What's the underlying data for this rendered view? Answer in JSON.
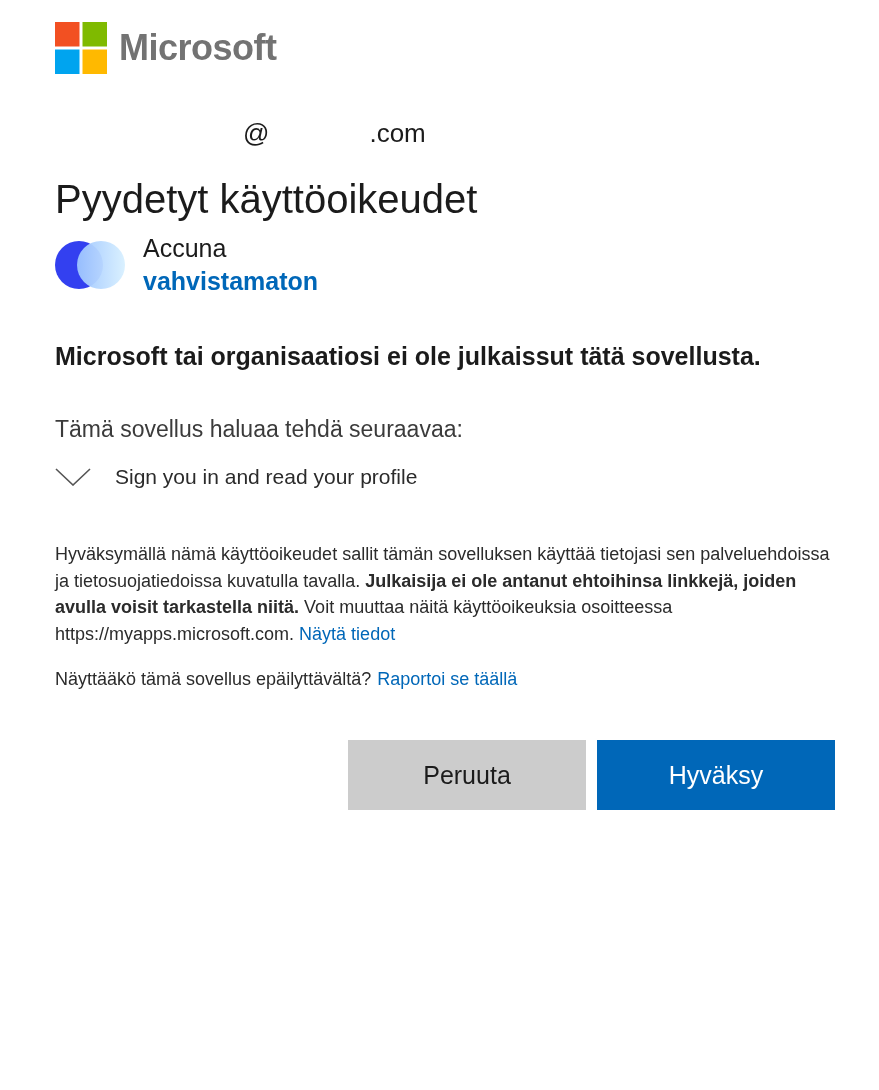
{
  "logo": {
    "text": "Microsoft"
  },
  "account": {
    "at": "@",
    "domain": ".com"
  },
  "title": "Pyydetyt käyttöoikeudet",
  "app": {
    "name": "Accuna",
    "status": "vahvistamaton"
  },
  "warning": "Microsoft tai organisaatiosi ei ole julkaissut tätä sovellusta.",
  "intro": "Tämä sovellus haluaa tehdä seuraavaa:",
  "permissions": [
    {
      "label": "Sign you in and read your profile",
      "expanded": false
    }
  ],
  "consent": {
    "text": "Hyväksymällä nämä käyttöoikeudet sallit tämän sovelluksen käyttää tietojasi sen palveluehdoissa ja tietosuojatiedoissa kuvatulla tavalla. **Julkaisija ei ole antanut ehtoihinsa linkkejä, joiden avulla voisit tarkastella niitä.** Voit muuttaa näitä käyttöoikeuksia osoitteessa https://myapps.microsoft.com.",
    "link": "Näytä tiedot"
  },
  "report": {
    "text": "Näyttääkö tämä sovellus epäilyttävältä?",
    "link": "Raportoi se täällä"
  },
  "buttons": [
    {
      "label": "Peruuta",
      "kind": "secondary"
    },
    {
      "label": "Hyväksy",
      "kind": "primary"
    }
  ]
}
